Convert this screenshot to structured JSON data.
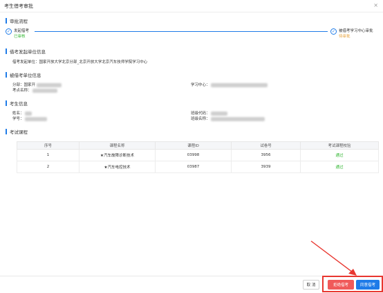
{
  "window": {
    "title": "考生借考审批",
    "close": "×"
  },
  "sections": {
    "process": "审批流程",
    "initiator": "借考发起单位信息",
    "borrowed": "被借考单位信息",
    "student": "考生信息",
    "courses": "考试课程"
  },
  "steps": [
    {
      "name": "发起借考",
      "status": "已审核",
      "icon": "check-icon"
    },
    {
      "name": "被借考学习中心审批",
      "status": "待审批",
      "icon": "check-icon"
    }
  ],
  "initiator_info": {
    "label": "借考发起单位：",
    "value": "国家开放大学北京分部_北京开放大学北京汽车技师学院学习中心"
  },
  "borrowed_info": {
    "branch_label": "分部：",
    "branch_value": "国家开",
    "exam_point_label": "考点名称：",
    "center_label": "学习中心："
  },
  "student_info": {
    "name_label": "姓名：",
    "student_no_label": "学号：",
    "class_code_label": "班级代码：",
    "class_name_label": "班级名称："
  },
  "table": {
    "headers": [
      "序号",
      "课程名称",
      "课程ID",
      "试卷号",
      "考试课程校验"
    ],
    "rows": [
      [
        "1",
        "★汽车故障诊断技术",
        "03998",
        "3956",
        "通过"
      ],
      [
        "2",
        "★汽车电控技术",
        "03987",
        "3939",
        "通过"
      ]
    ]
  },
  "buttons": {
    "cancel": "取 消",
    "reject": "拒绝借考",
    "approve": "同意借考"
  },
  "colors": {
    "accent": "#1e7be8",
    "reject": "#f05a5a",
    "pass": "#2db52d",
    "pending": "#e6a23c",
    "annotation": "#e8362f"
  }
}
